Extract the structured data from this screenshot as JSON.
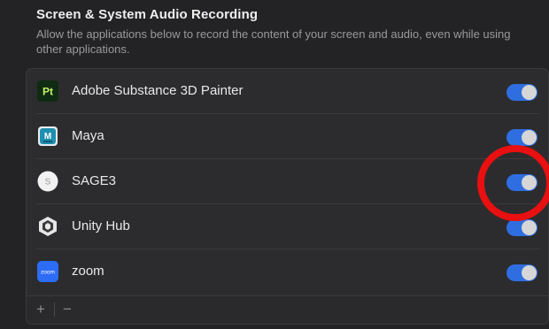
{
  "section": {
    "title": "Screen & System Audio Recording",
    "description": "Allow the applications below to record the content of your screen and audio, even while using other applications."
  },
  "apps": [
    {
      "name": "Adobe Substance 3D Painter",
      "icon": "substance-painter-icon",
      "icon_text": "Pt",
      "enabled": true
    },
    {
      "name": "Maya",
      "icon": "maya-icon",
      "icon_text": "M",
      "enabled": true
    },
    {
      "name": "SAGE3",
      "icon": "sage3-icon",
      "icon_text": "S",
      "enabled": true
    },
    {
      "name": "Unity Hub",
      "icon": "unity-hub-icon",
      "icon_text": "",
      "enabled": true
    },
    {
      "name": "zoom",
      "icon": "zoom-icon",
      "icon_text": "zoom",
      "enabled": true
    }
  ],
  "toolbar": {
    "add_label": "+",
    "remove_label": "−"
  },
  "colors": {
    "toggle_on": "#2f6ee0",
    "highlight": "#e81010"
  }
}
